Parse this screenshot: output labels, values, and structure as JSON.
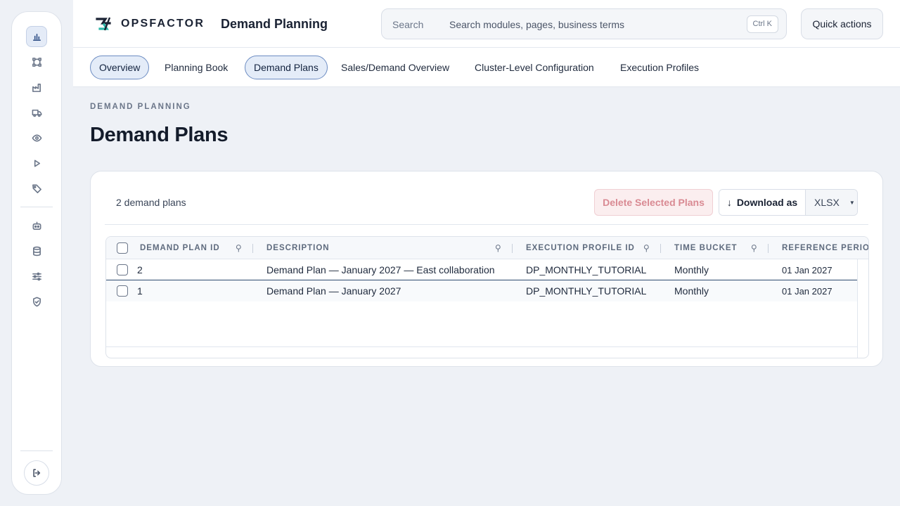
{
  "brand": {
    "name": "OPSFACTOR"
  },
  "header": {
    "app_title": "Demand Planning",
    "search_label": "Search",
    "search_placeholder": "Search modules, pages, business terms",
    "search_shortcut": "Ctrl K",
    "quick_actions": "Quick actions"
  },
  "rail": {
    "items": [
      "bar-chart-icon",
      "network-icon",
      "factory-icon",
      "truck-icon",
      "eye-icon",
      "play-icon",
      "tag-icon",
      "robot-icon",
      "database-icon",
      "sliders-icon",
      "shield-check-icon"
    ],
    "active": "bar-chart-icon",
    "logout": "logout-icon"
  },
  "tabs": [
    {
      "label": "Overview",
      "active": true
    },
    {
      "label": "Planning Book",
      "active": false
    },
    {
      "label": "Demand Plans",
      "active": true
    },
    {
      "label": "Sales/Demand Overview",
      "active": false
    },
    {
      "label": "Cluster-Level Configuration",
      "active": false
    },
    {
      "label": "Execution Profiles",
      "active": false
    }
  ],
  "page": {
    "eyebrow": "DEMAND PLANNING",
    "title": "Demand Plans"
  },
  "card": {
    "count": "2 demand plans",
    "delete_label": "Delete Selected Plans",
    "download_label": "Download as",
    "download_arrow": "↓",
    "format": "XLSX"
  },
  "table": {
    "columns": [
      "DEMAND PLAN ID",
      "DESCRIPTION",
      "EXECUTION PROFILE ID",
      "TIME BUCKET",
      "REFERENCE PERIOD"
    ],
    "rows": [
      {
        "id": "2",
        "description": "Demand Plan — January 2027 — East collaboration",
        "profile": "DP_MONTHLY_TUTORIAL",
        "bucket": "Monthly",
        "period": "01 Jan 2027"
      },
      {
        "id": "1",
        "description": "Demand Plan — January 2027",
        "profile": "DP_MONTHLY_TUTORIAL",
        "bucket": "Monthly",
        "period": "01 Jan 2027"
      }
    ]
  },
  "colors": {
    "accent": "#6c8cc2",
    "danger_text": "#d98a93",
    "brand_teal": "#2bb7a8"
  }
}
